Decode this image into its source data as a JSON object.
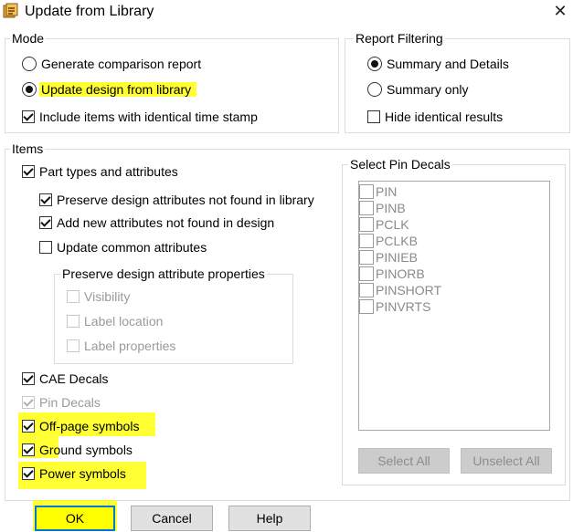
{
  "window": {
    "title": "Update from Library",
    "close_glyph": "✕"
  },
  "mode": {
    "legend": "Mode",
    "options": [
      {
        "label": "Generate comparison report",
        "checked": false
      },
      {
        "label": "Update design from library",
        "checked": true
      }
    ],
    "identical_timestamp": {
      "label": "Include items with identical time stamp",
      "checked": true
    }
  },
  "report_filtering": {
    "legend": "Report Filtering",
    "options": [
      {
        "label": "Summary and Details",
        "checked": true
      },
      {
        "label": "Summary only",
        "checked": false
      }
    ],
    "hide_identical": {
      "label": "Hide identical results",
      "checked": false
    }
  },
  "items": {
    "legend": "Items",
    "part_types": {
      "label": "Part types and attributes",
      "checked": true
    },
    "preserve_not_found": {
      "label": "Preserve design attributes not found in library",
      "checked": true
    },
    "add_new": {
      "label": "Add new attributes not found in design",
      "checked": true
    },
    "update_common": {
      "label": "Update common attributes",
      "checked": false
    },
    "preserve_props": {
      "legend": "Preserve design attribute properties",
      "visibility": "Visibility",
      "label_location": "Label location",
      "label_properties": "Label properties"
    },
    "cae_decals": {
      "label": "CAE Decals",
      "checked": true
    },
    "pin_decals": {
      "label": "Pin Decals",
      "checked": true,
      "disabled": true
    },
    "off_page": {
      "label": "Off-page symbols",
      "checked": true
    },
    "ground": {
      "label": "Ground symbols",
      "checked": true
    },
    "power": {
      "label": "Power symbols",
      "checked": true
    }
  },
  "pin_decals": {
    "legend": "Select Pin Decals",
    "items": [
      "PIN",
      "PINB",
      "PCLK",
      "PCLKB",
      "PINIEB",
      "PINORB",
      "PINSHORT",
      "PINVRTS"
    ],
    "select_all": "Select All",
    "unselect_all": "Unselect All"
  },
  "buttons": {
    "ok": "OK",
    "cancel": "Cancel",
    "help": "Help"
  },
  "colors": {
    "highlight": "#ffff00",
    "focus": "#0078d7"
  }
}
